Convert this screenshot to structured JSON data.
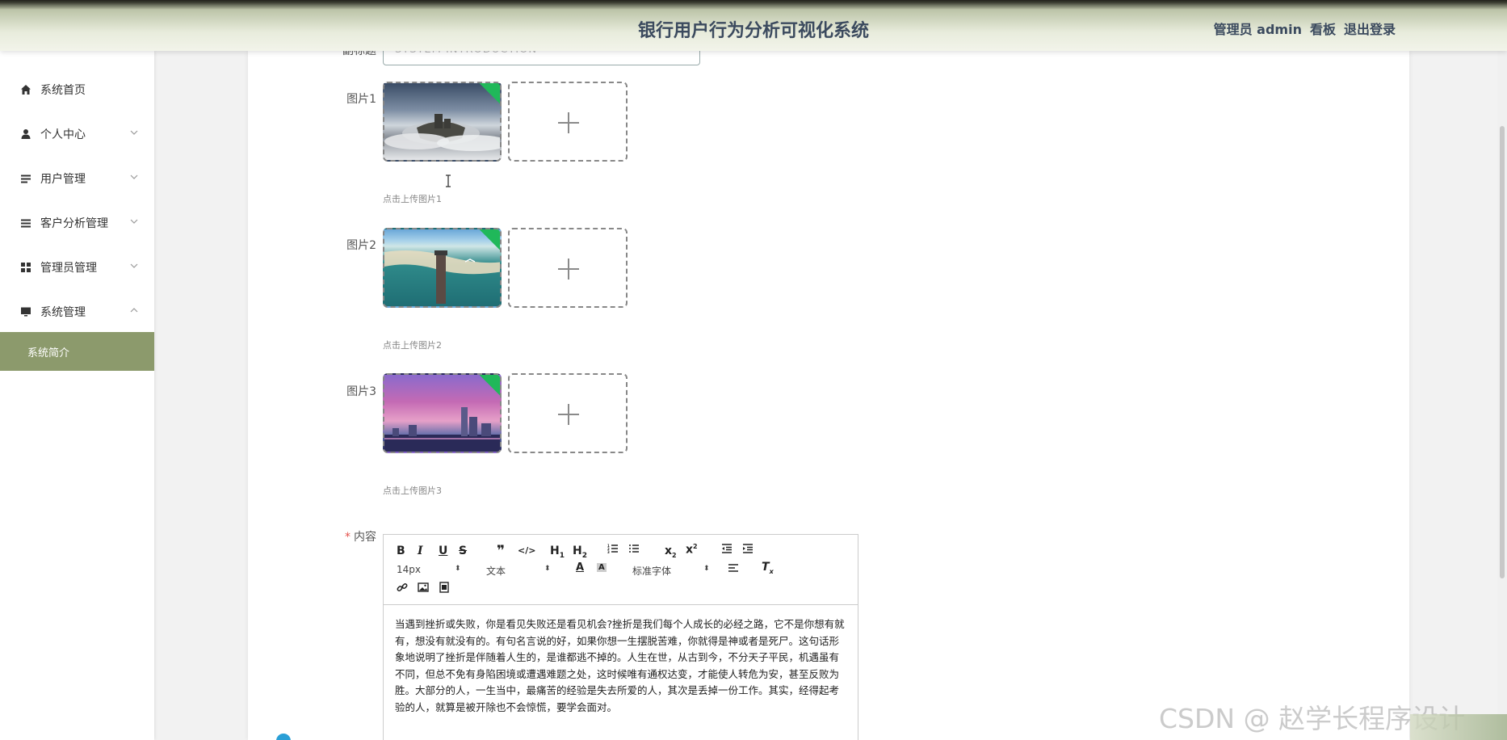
{
  "header": {
    "title": "银行用户行为分析可视化系统",
    "user": "管理员 admin",
    "dashboard": "看板",
    "logout": "退出登录"
  },
  "sidebar": {
    "items": [
      {
        "label": "系统首页",
        "icon": "home-icon"
      },
      {
        "label": "个人中心",
        "icon": "user-icon"
      },
      {
        "label": "用户管理",
        "icon": "list-icon"
      },
      {
        "label": "客户分析管理",
        "icon": "list-icon"
      },
      {
        "label": "管理员管理",
        "icon": "grid-icon"
      },
      {
        "label": "系统管理",
        "icon": "monitor-icon"
      }
    ],
    "active_sub": "系统简介"
  },
  "form": {
    "subtitle_label": "副标题",
    "subtitle_value": "SYSTEM INTRODUCTION",
    "pic1_label": "图片1",
    "pic1_hint": "点击上传图片1",
    "pic2_label": "图片2",
    "pic2_hint": "点击上传图片2",
    "pic3_label": "图片3",
    "pic3_hint": "点击上传图片3",
    "content_label": "内容"
  },
  "editor": {
    "font_size": "14px",
    "block_type": "文本",
    "font_family": "标准字体",
    "body": "当遇到挫折或失败，你是看见失败还是看见机会?挫折是我们每个人成长的必经之路，它不是你想有就有，想没有就没有的。有句名言说的好，如果你想一生摆脱苦难，你就得是神或者是死尸。这句话形象地说明了挫折是伴随着人生的，是谁都逃不掉的。人生在世，从古到今，不分天子平民，机遇虽有不同，但总不免有身陷困境或遭遇难题之处，这时候唯有通权达变，才能使人转危为安，甚至反败为胜。大部分的人，一生当中，最痛苦的经验是失去所爱的人，其次是丢掉一份工作。其实，经得起考验的人，就算是被开除也不会惊慌，要学会面对。"
  },
  "watermark": "CSDN @ 赵学长程序设计"
}
